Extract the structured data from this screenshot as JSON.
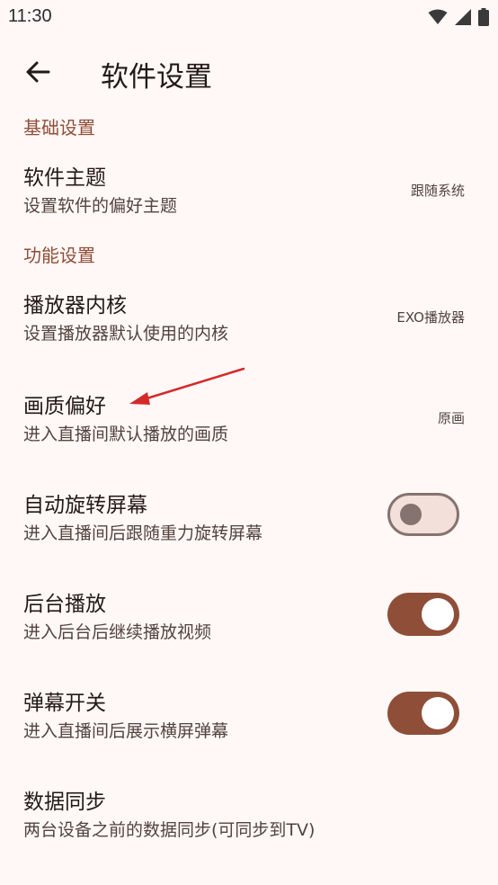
{
  "status_bar": {
    "time": "11:30",
    "icons": [
      "wifi-icon",
      "signal-icon",
      "battery-icon"
    ]
  },
  "app_bar": {
    "title": "软件设置",
    "back_icon": "arrow-back-icon"
  },
  "sections": {
    "basic": {
      "header": "基础设置"
    },
    "function": {
      "header": "功能设置"
    }
  },
  "settings": {
    "theme": {
      "title": "软件主题",
      "summary": "设置软件的偏好主题",
      "value": "跟随系统"
    },
    "player_core": {
      "title": "播放器内核",
      "summary": "设置播放器默认使用的内核",
      "value": "EXO播放器"
    },
    "quality": {
      "title": "画质偏好",
      "summary": "进入直播间默认播放的画质",
      "value": "原画"
    },
    "auto_rotate": {
      "title": "自动旋转屏幕",
      "summary": "进入直播间后跟随重力旋转屏幕",
      "enabled": false
    },
    "background_play": {
      "title": "后台播放",
      "summary": "进入后台后继续播放视频",
      "enabled": true
    },
    "danmaku": {
      "title": "弹幕开关",
      "summary": "进入直播间后展示横屏弹幕",
      "enabled": true
    },
    "data_sync": {
      "title": "数据同步",
      "summary": "两台设备之前的数据同步(可同步到TV)"
    }
  },
  "colors": {
    "accent": "#8f4e38",
    "background": "#fff8f6",
    "annotation_arrow": "#d42a2a"
  }
}
